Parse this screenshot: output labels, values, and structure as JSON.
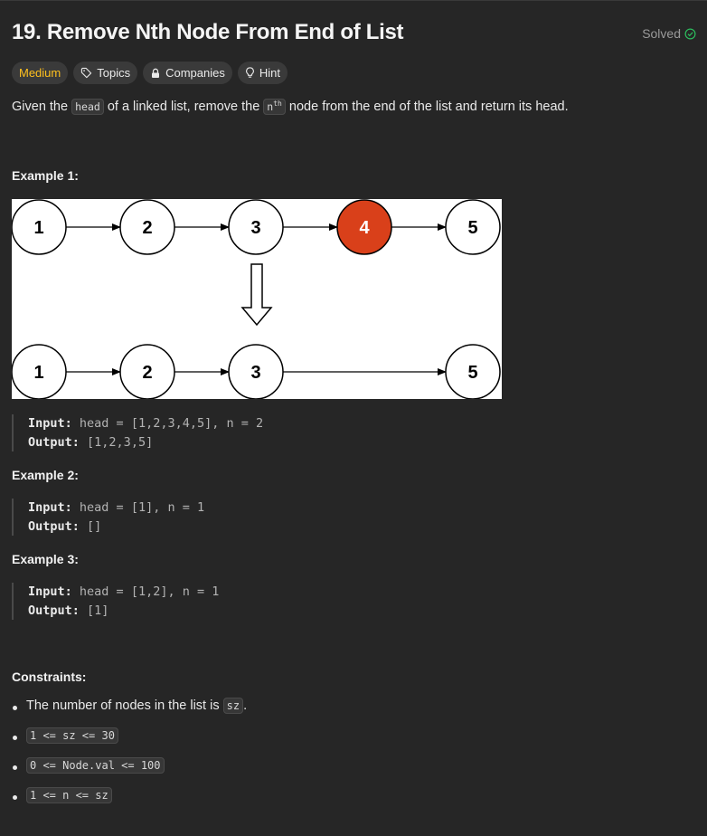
{
  "problem": {
    "title": "19. Remove Nth Node From End of List",
    "status": "Solved"
  },
  "tags": {
    "difficulty": "Medium",
    "topics": "Topics",
    "companies": "Companies",
    "hint": "Hint"
  },
  "description": {
    "part1": "Given the ",
    "code1": "head",
    "part2": " of a linked list, remove the ",
    "code2": "n",
    "code2_sup": "th",
    "part3": " node from the end of the list and return its head."
  },
  "examples": [
    {
      "heading": "Example 1:",
      "input_label": "Input:",
      "input_value": "head = [1,2,3,4,5], n = 2",
      "output_label": "Output:",
      "output_value": "[1,2,3,5]",
      "diagram": {
        "before": [
          "1",
          "2",
          "3",
          "4",
          "5"
        ],
        "after": [
          "1",
          "2",
          "3",
          "5"
        ],
        "removed": "4",
        "node_color": "#ffffff",
        "removed_color": "#d9401a"
      }
    },
    {
      "heading": "Example 2:",
      "input_label": "Input:",
      "input_value": "head = [1], n = 1",
      "output_label": "Output:",
      "output_value": "[]"
    },
    {
      "heading": "Example 3:",
      "input_label": "Input:",
      "input_value": "head = [1,2], n = 1",
      "output_label": "Output:",
      "output_value": "[1]"
    }
  ],
  "constraints": {
    "heading": "Constraints:",
    "item1_text": "The number of nodes in the list is ",
    "item1_code": "sz",
    "item1_end": ".",
    "items_code": [
      "1 <= sz <= 30",
      "0 <= Node.val <= 100",
      "1 <= n <= sz"
    ]
  },
  "colors": {
    "background": "#262626",
    "medium": "#ffc01e",
    "solved_check": "#2cbb5d"
  }
}
